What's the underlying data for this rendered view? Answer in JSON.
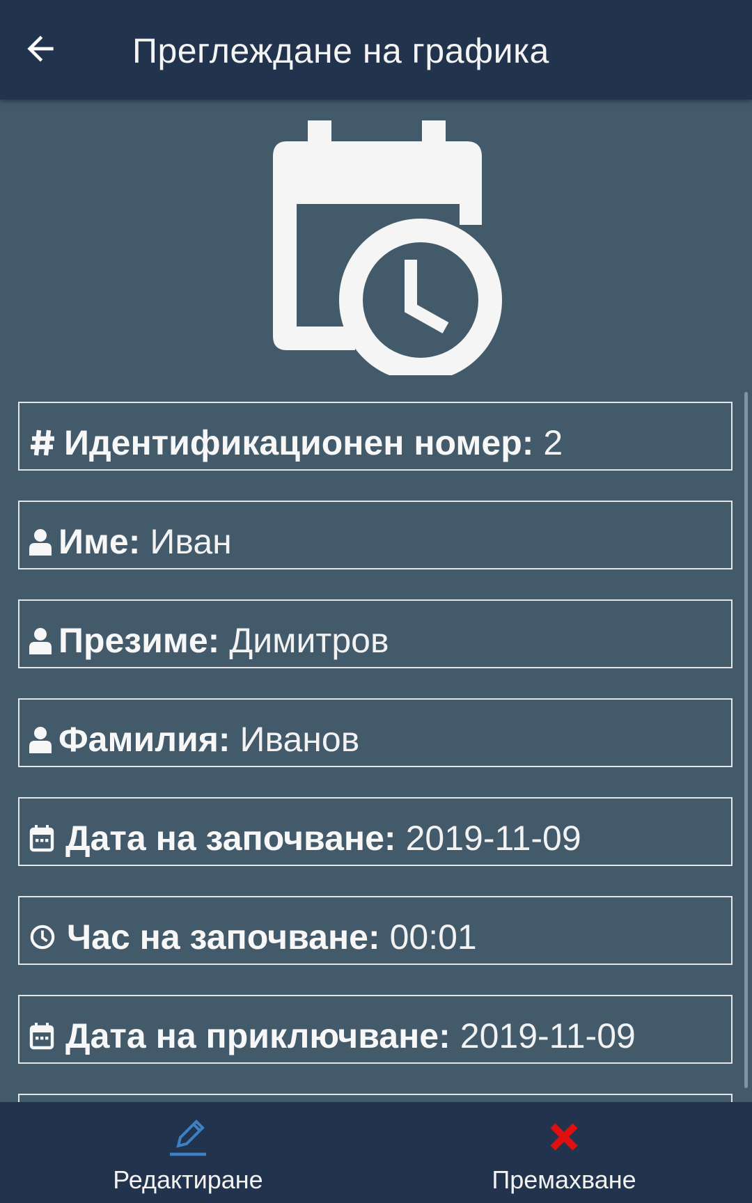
{
  "header": {
    "title": "Преглеждане на графика",
    "back_icon": "arrow-left-icon"
  },
  "hero": {
    "icon": "calendar-clock-icon"
  },
  "fields": [
    {
      "icon": "hash-icon",
      "label": "Идентификационен номер:",
      "value": "2"
    },
    {
      "icon": "user-icon",
      "label": "Име:",
      "value": "Иван"
    },
    {
      "icon": "user-icon",
      "label": "Презиме:",
      "value": "Димитров"
    },
    {
      "icon": "user-icon",
      "label": "Фамилия:",
      "value": "Иванов"
    },
    {
      "icon": "calendar-icon",
      "label": "Дата на започване:",
      "value": "2019-11-09"
    },
    {
      "icon": "clock-icon",
      "label": "Час на започване:",
      "value": "00:01"
    },
    {
      "icon": "calendar-icon",
      "label": "Дата на приключване:",
      "value": "2019-11-09"
    }
  ],
  "bottom_bar": {
    "edit_label": "Редактиране",
    "edit_icon": "pencil-icon",
    "remove_label": "Премахване",
    "remove_icon": "x-icon"
  },
  "colors": {
    "header_bg": "#22344d",
    "content_bg": "#435a6b",
    "edit_accent": "#3f7fc4",
    "remove_accent": "#e01010"
  }
}
